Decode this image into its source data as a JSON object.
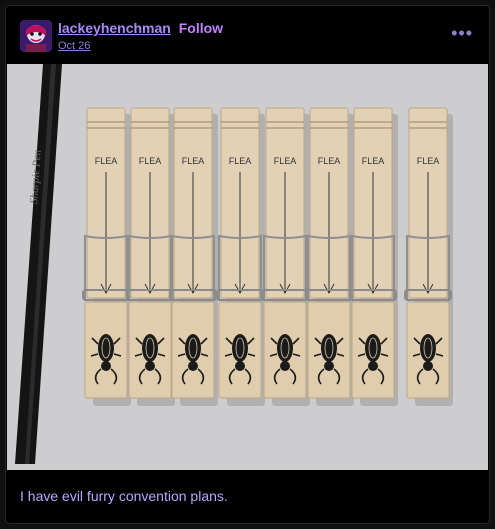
{
  "post": {
    "username": "lackeyhenchman",
    "follow_label": "Follow",
    "date": "Oct 26",
    "more_icon": "ellipsis-icon",
    "caption": "I have evil furry convention plans."
  },
  "photo": {
    "clip_label": "FLEA",
    "pen_text": "Sharpie Pen"
  },
  "colors": {
    "background": "#000000",
    "username": "#a78bfa",
    "follow": "#c084fc",
    "caption": "#b9a7ff",
    "photo_bg": "#cfcfd1",
    "wood": "#e3d2b6"
  }
}
